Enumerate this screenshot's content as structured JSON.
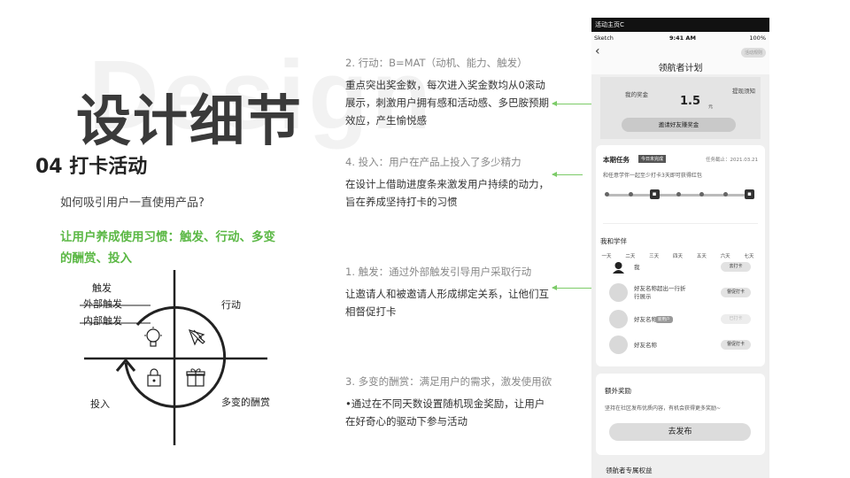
{
  "watermark": "Design",
  "main_title": "设计细节",
  "section_title": "04 打卡活动",
  "question": "如何吸引用户一直使用产品?",
  "answer": "让用户养成使用习惯：触发、行动、多变的酬赏、投入",
  "diagram": {
    "trigger": "触发",
    "external": "外部触发",
    "internal": "内部触发",
    "action": "行动",
    "investment": "投入",
    "reward": "多变的酬赏"
  },
  "points": [
    {
      "head": "2.  行动：B=MAT（动机、能力、触发）",
      "body": "重点突出奖金数，每次进入奖金数均从0滚动展示，刺激用户拥有感和活动感、多巴胺预期效应，产生愉悦感"
    },
    {
      "head": "4.  投入：用户在产品上投入了多少精力",
      "body": "在设计上借助进度条来激发用户持续的动力，旨在养成坚持打卡的习惯"
    },
    {
      "head": "1.  触发：通过外部触发引导用户采取行动",
      "body": "让邀请人和被邀请人形成绑定关系，让他们互相督促打卡"
    },
    {
      "head": "3.  多变的酬赏：满足用户的需求，激发使用欲",
      "body": "•通过在不同天数设置随机现金奖励，让用户在好奇心的驱动下参与活动"
    }
  ],
  "phone": {
    "topbar": "活动主页C",
    "status": {
      "carrier": "Sketch",
      "time": "9:41 AM",
      "battery": "100%"
    },
    "nav_title": "领航者计划",
    "rules": "活动规则",
    "bonus": {
      "label": "我的奖金",
      "value": "1.5",
      "unit": "元",
      "withdraw": "提现须知",
      "invite": "邀请好友赚奖金"
    },
    "task": {
      "title": "本期任务",
      "badge": "今日未完成",
      "deadline": "任务截止：2021.03.21",
      "desc": "和任意学伴一起至少打卡3天即可获得红包",
      "progress": 0.0,
      "days": [
        "一天",
        "二天",
        "三天",
        "四天",
        "五天",
        "六天",
        "七天"
      ]
    },
    "members": {
      "title": "我和学伴",
      "rows": [
        {
          "name": "我",
          "tag": "",
          "button": "去打卡"
        },
        {
          "name": "好友名称超出一行折行展示",
          "tag": "",
          "button": "督促打卡"
        },
        {
          "name": "好友名称",
          "tag": "新用户",
          "button": "已打卡"
        },
        {
          "name": "好友名称",
          "tag": "",
          "button": "督促打卡"
        }
      ]
    },
    "extra": {
      "title": "额外奖励",
      "desc": "坚持在社区发布优质内容，有机会获得更多奖励~",
      "button": "去发布"
    },
    "privilege": "领航者专属权益"
  }
}
